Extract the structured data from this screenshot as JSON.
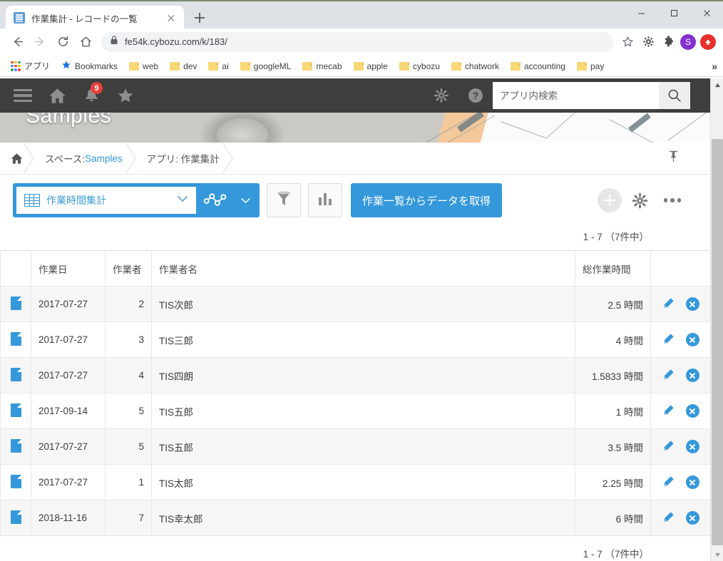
{
  "browser": {
    "tab": {
      "title": "作業集計 - レコードの一覧",
      "favicon": "kintone-icon",
      "close": "close-icon"
    },
    "new_tab": "new-tab-icon",
    "window": {
      "minimize": "—",
      "maximize": "▢",
      "close": "✕"
    },
    "nav": {
      "back": "←",
      "forward": "→",
      "reload": "⟳",
      "home": "⌂"
    },
    "url": "fe54k.cybozu.com/k/183/",
    "lock": "lock-icon",
    "star": "star-icon",
    "extensions": [
      "gear-icon",
      "puzzle-icon"
    ],
    "profile_initial": "S",
    "update_icon": "update-arrow-icon",
    "bookmarks": [
      {
        "label": "アプリ",
        "icon": "apps-grid-icon"
      },
      {
        "label": "Bookmarks",
        "icon": "star-icon"
      },
      {
        "label": "web",
        "icon": "folder-icon"
      },
      {
        "label": "dev",
        "icon": "folder-icon"
      },
      {
        "label": "ai",
        "icon": "folder-icon"
      },
      {
        "label": "googleML",
        "icon": "folder-icon"
      },
      {
        "label": "mecab",
        "icon": "folder-icon"
      },
      {
        "label": "apple",
        "icon": "folder-icon"
      },
      {
        "label": "cybozu",
        "icon": "folder-icon"
      },
      {
        "label": "chatwork",
        "icon": "folder-icon"
      },
      {
        "label": "accounting",
        "icon": "folder-icon"
      },
      {
        "label": "pay",
        "icon": "folder-icon"
      }
    ],
    "bookmark_overflow": "»"
  },
  "app_header": {
    "menu_icon": "hamburger-icon",
    "home_icon": "home-icon",
    "notifications_icon": "bell-icon",
    "notifications_badge": "9",
    "favorites_icon": "star-icon",
    "settings_icon": "gear-icon",
    "help_icon": "help-icon",
    "search_placeholder": "アプリ内検索",
    "search_value": "",
    "search_button_icon": "search-icon"
  },
  "banner": {
    "space_title": "Samples"
  },
  "breadcrumb": {
    "home_icon": "home-icon",
    "space_prefix": "スペース: ",
    "space_name": "Samples",
    "app": "アプリ: 作業集計",
    "pin_icon": "pin-icon"
  },
  "toolbar": {
    "view_name": "作業時間集計",
    "view_icon": "table-view-icon",
    "view_chevron": "chevron-down-icon",
    "graph_icon": "graph-view-icon",
    "graph_chevron": "chevron-down-icon",
    "filter_icon": "filter-funnel-icon",
    "chart_icon": "bar-chart-icon",
    "primary_button": "作業一覧からデータを取得",
    "add_icon": "plus-icon",
    "settings_icon": "gear-icon",
    "more_icon": "ellipsis-icon"
  },
  "pagination": {
    "top": "1 - 7 （7件中）",
    "bottom": "1 - 7 （7件中）"
  },
  "table": {
    "columns": [
      "",
      "作業日",
      "作業者",
      "作業者名",
      "総作業時間",
      ""
    ],
    "rows": [
      {
        "icon": "record-icon",
        "date": "2017-07-27",
        "worker": "2",
        "name": "TIS次郎",
        "hours": "2.5 時間",
        "edit": "pencil-icon",
        "delete": "delete-icon"
      },
      {
        "icon": "record-icon",
        "date": "2017-07-27",
        "worker": "3",
        "name": "TIS三郎",
        "hours": "4 時間",
        "edit": "pencil-icon",
        "delete": "delete-icon"
      },
      {
        "icon": "record-icon",
        "date": "2017-07-27",
        "worker": "4",
        "name": "TIS四朗",
        "hours": "1.5833 時間",
        "edit": "pencil-icon",
        "delete": "delete-icon"
      },
      {
        "icon": "record-icon",
        "date": "2017-09-14",
        "worker": "5",
        "name": "TIS五郎",
        "hours": "1 時間",
        "edit": "pencil-icon",
        "delete": "delete-icon"
      },
      {
        "icon": "record-icon",
        "date": "2017-07-27",
        "worker": "5",
        "name": "TIS五郎",
        "hours": "3.5 時間",
        "edit": "pencil-icon",
        "delete": "delete-icon"
      },
      {
        "icon": "record-icon",
        "date": "2017-07-27",
        "worker": "1",
        "name": "TIS太郎",
        "hours": "2.25 時間",
        "edit": "pencil-icon",
        "delete": "delete-icon"
      },
      {
        "icon": "record-icon",
        "date": "2018-11-16",
        "worker": "7",
        "name": "TIS幸太郎",
        "hours": "6 時間",
        "edit": "pencil-icon",
        "delete": "delete-icon"
      }
    ]
  },
  "colors": {
    "accent": "#3498db",
    "header_bar": "#3e3e3e",
    "badge_red": "#e8413b",
    "alt_row": "#f6f6f6"
  },
  "scrollbar": {
    "up": "▲",
    "down": "▼"
  }
}
